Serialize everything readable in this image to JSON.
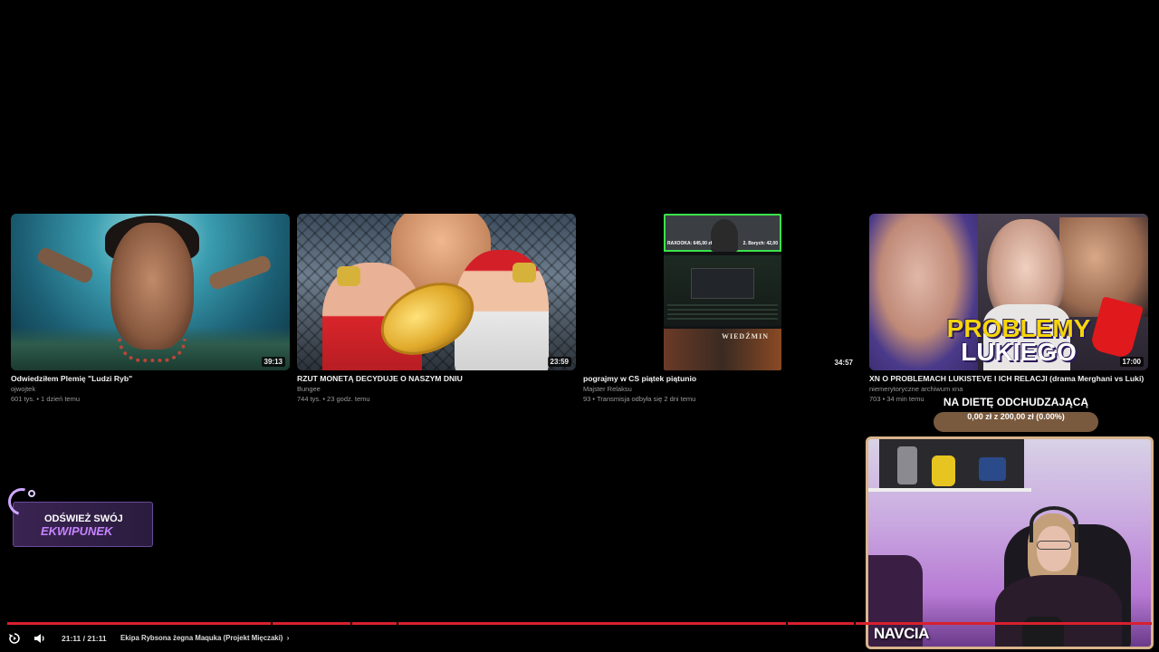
{
  "videos": [
    {
      "title": "Odwiedziłem Plemię \"Ludzi Ryb\"",
      "channel": "ojwojtek",
      "meta": "601 tys. • 1 dzień temu",
      "duration": "39:13"
    },
    {
      "title": "RZUT MONETĄ DECYDUJE O NASZYM DNIU",
      "channel": "Bungee",
      "meta": "744 tys. • 23 godz. temu",
      "duration": "23:59"
    },
    {
      "title": "pograjmy w CS piątek piątunio",
      "channel": "Majster Relaksu",
      "meta": "93 • Transmisja odbyła się 2 dni temu",
      "duration": "34:57",
      "cam_left": "RAXOOKA: 645,00 zł",
      "cam_right": "2. Borych: 42,00",
      "game_title": "WIEDŹMIN"
    },
    {
      "title": "XN O PROBLEMACH LUKISTEVE I ICH RELACJI (drama Merghani vs Luki)",
      "channel": "niemerytoryczne archiwum xna",
      "meta": "703 • 34 min temu",
      "duration": "17:00",
      "overlay_line1": "PROBLEMY",
      "overlay_line2": "LUKIEGO"
    }
  ],
  "banner": {
    "line1": "ODŚWIEŻ SWÓJ",
    "line2": "EKWIPUNEK"
  },
  "goal": {
    "title": "NA DIETĘ ODCHUDZAJĄCĄ",
    "amount_text": "0,00 zł z 200,00 zł (0.00%)",
    "progress": 0.0
  },
  "webcam": {
    "name": "NAVCIA"
  },
  "player": {
    "time": "21:11 / 21:11",
    "chapter": "Ekipa Rybsona żegna Maquka (Projekt Mięczaki)",
    "progress": 1.0,
    "chapter_marks": [
      0.23,
      0.3,
      0.34,
      0.68,
      0.74
    ]
  },
  "icons": {
    "replay": "replay-icon",
    "volume": "volume-icon",
    "chevron": "chevron-right-icon"
  },
  "colors": {
    "progress": "#d8202e",
    "goal_bar": "#7a5a3e",
    "accent_purple": "#c784ff"
  }
}
